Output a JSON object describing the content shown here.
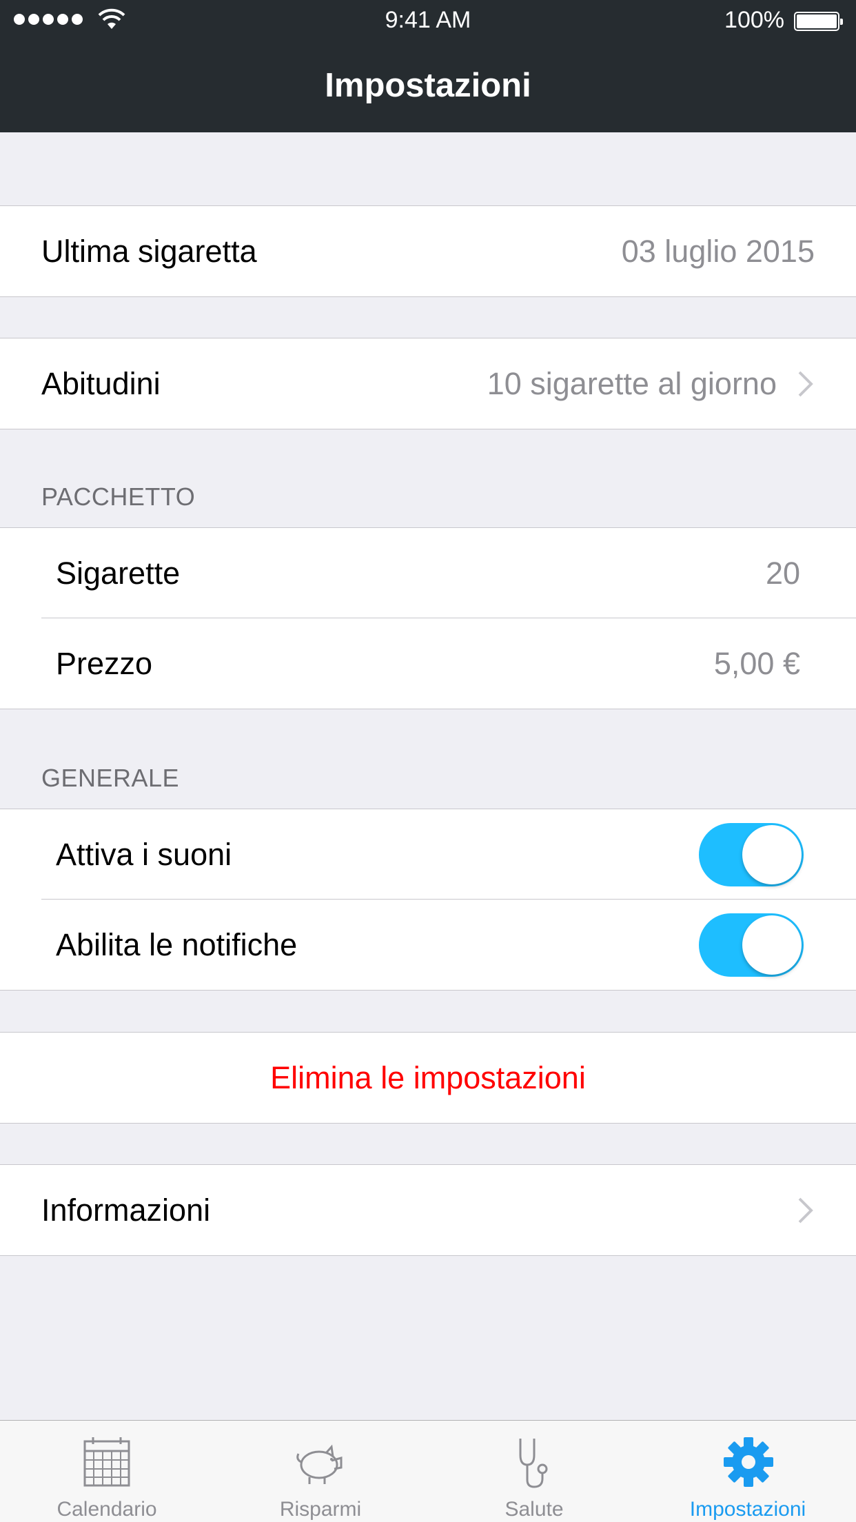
{
  "status_bar": {
    "time": "9:41 AM",
    "battery": "100%"
  },
  "nav": {
    "title": "Impostazioni"
  },
  "last_cigarette": {
    "label": "Ultima sigaretta",
    "value": "03 luglio 2015"
  },
  "habits": {
    "label": "Abitudini",
    "value": "10 sigarette al giorno"
  },
  "package": {
    "header": "PACCHETTO",
    "cigarettes_label": "Sigarette",
    "cigarettes_value": "20",
    "price_label": "Prezzo",
    "price_value": "5,00 €"
  },
  "general": {
    "header": "GENERALE",
    "sounds_label": "Attiva i suoni",
    "sounds_on": true,
    "notifications_label": "Abilita le notifiche",
    "notifications_on": true
  },
  "reset": {
    "label": "Elimina le impostazioni"
  },
  "info": {
    "label": "Informazioni"
  },
  "tabs": [
    {
      "label": "Calendario",
      "icon": "calendar-icon"
    },
    {
      "label": "Risparmi",
      "icon": "piggy-bank-icon"
    },
    {
      "label": "Salute",
      "icon": "stethoscope-icon"
    },
    {
      "label": "Impostazioni",
      "icon": "gear-icon",
      "active": true
    }
  ],
  "colors": {
    "accent": "#1ebeff",
    "tab_active": "#1a9bf0",
    "danger": "#ff0000",
    "header_bg": "#262c30"
  }
}
